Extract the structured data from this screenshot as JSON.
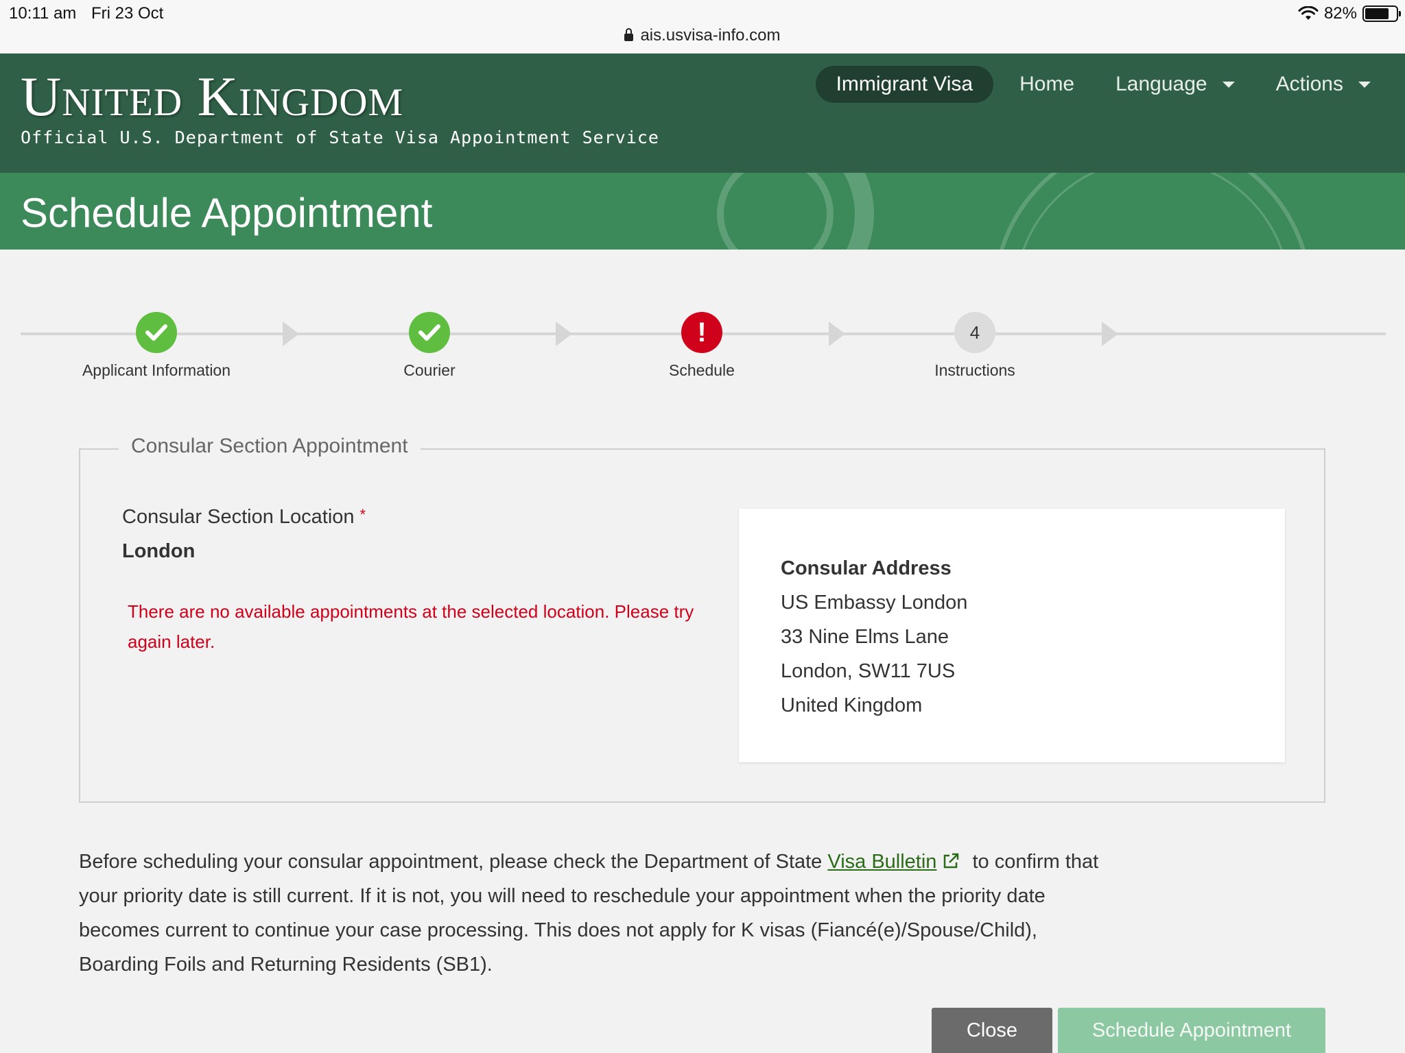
{
  "status_bar": {
    "time": "10:11 am",
    "date": "Fri 23 Oct",
    "battery": "82%",
    "battery_level": 0.82,
    "url": "ais.usvisa-info.com"
  },
  "header": {
    "brand": "United Kingdom",
    "subtitle": "Official U.S. Department of State Visa Appointment Service",
    "nav": {
      "immigrant_visa": "Immigrant Visa",
      "home": "Home",
      "language": "Language",
      "actions": "Actions"
    }
  },
  "page": {
    "title": "Schedule Appointment"
  },
  "steps": [
    {
      "label": "Applicant Information",
      "state": "done"
    },
    {
      "label": "Courier",
      "state": "done"
    },
    {
      "label": "Schedule",
      "state": "error"
    },
    {
      "label": "Instructions",
      "state": "pending",
      "number": "4"
    }
  ],
  "consular": {
    "legend": "Consular Section Appointment",
    "location_label": "Consular Section Location",
    "required_marker": "*",
    "location_value": "London",
    "error": "There are no available appointments at the selected location. Please try again later.",
    "address": {
      "title": "Consular Address",
      "lines": [
        "US Embassy London",
        "33 Nine Elms Lane",
        "London, SW11 7US",
        "United Kingdom"
      ]
    }
  },
  "bulletin": {
    "before": "Before scheduling your consular appointment, please check the Department of State ",
    "link": "Visa Bulletin",
    "after": " to confirm that your priority date is still current. If it is not, you will need to reschedule your appointment when the priority date becomes current to continue your case processing. This does not apply for K visas (Fiancé(e)/Spouse/Child), Boarding Foils and Returning Residents (SB1)."
  },
  "buttons": {
    "close": "Close",
    "schedule": "Schedule Appointment"
  },
  "colors": {
    "header_bg": "#2f5f46",
    "title_band_bg": "#3c8a5a",
    "done": "#5fbd3f",
    "error": "#d0021b",
    "link": "#2a6b17"
  }
}
